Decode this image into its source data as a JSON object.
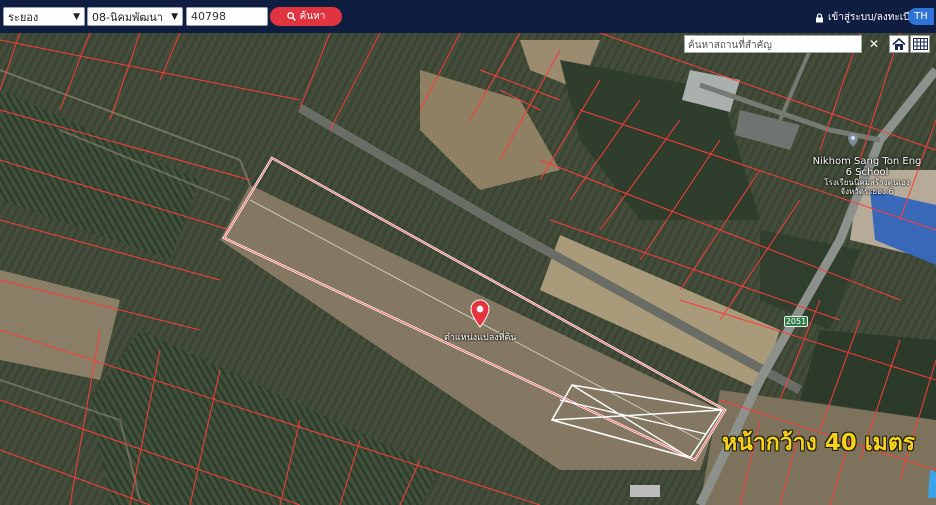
{
  "toolbar": {
    "province": "ระยอง",
    "district": "08-นิคมพัฒนา",
    "parcel_no": "40798",
    "search_label": "ค้นหา",
    "login_label": "เข้าสู่ระบบ/ลงทะเบียน",
    "lang_label": "TH"
  },
  "map": {
    "poi_search_placeholder": "ค้นหาสถานที่สำคัญ",
    "pin_label": "ตำแหน่งแปลงที่ดิน",
    "school_name_en": "Nikhom Sang Ton Eng 6 School",
    "school_name_th": "โรงเรียนนิคมสร้างตนเอง จังหวัดระยอง 6",
    "road_number": "2051",
    "overlay_text": "หน้ากว้าง 40 เมตร",
    "colors": {
      "parcel_lines": "#ff3b3b",
      "highlight_parcel": "#ffffff",
      "pin": "#e8333f",
      "overlay_text": "#f6d21a",
      "topbar": "#0f1d40"
    }
  }
}
